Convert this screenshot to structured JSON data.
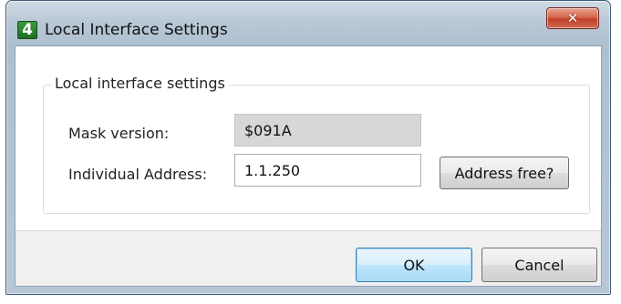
{
  "window": {
    "title": "Local Interface Settings",
    "app_icon_glyph": "4",
    "close_glyph": "✕"
  },
  "group": {
    "title": "Local interface settings"
  },
  "mask_version": {
    "label": "Mask version:",
    "value": "$091A"
  },
  "individual_address": {
    "label": "Individual Address:",
    "value": "1.1.250"
  },
  "buttons": {
    "address_free": "Address free?",
    "ok": "OK",
    "cancel": "Cancel"
  },
  "colors": {
    "window_frame": "#b9c8d6",
    "close_button": "#c2402a",
    "default_button_border": "#3c7fb1",
    "readonly_field": "#d7d7d7"
  },
  "icons": {
    "app": "app-logo-icon",
    "close": "close-icon"
  }
}
